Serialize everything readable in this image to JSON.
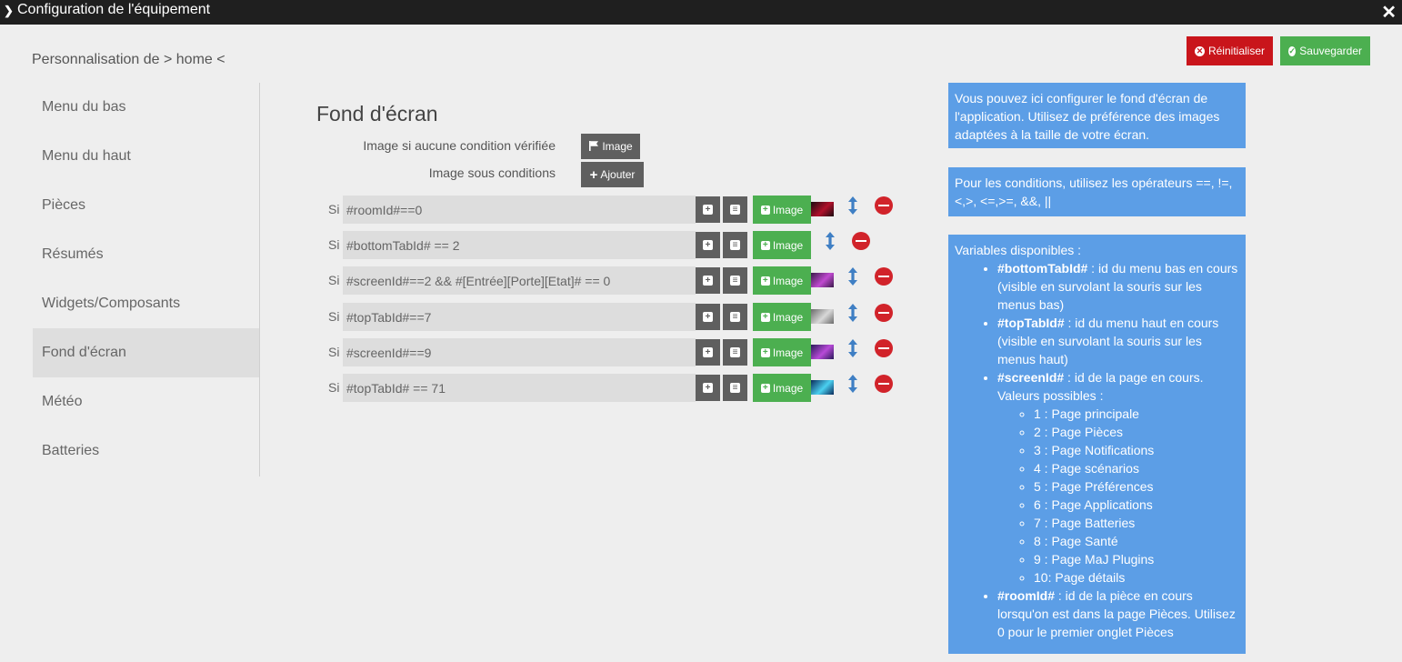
{
  "window": {
    "title": "Configuration de l'équipement"
  },
  "subtitle": "Personnalisation de > home <",
  "toolbar": {
    "reset_label": "Réinitialiser",
    "save_label": "Sauvegarder"
  },
  "sidebar": {
    "items": [
      {
        "label": "Menu du bas"
      },
      {
        "label": "Menu du haut"
      },
      {
        "label": "Pièces"
      },
      {
        "label": "Résumés"
      },
      {
        "label": "Widgets/Composants"
      },
      {
        "label": "Fond d'écran"
      },
      {
        "label": "Météo"
      },
      {
        "label": "Batteries"
      }
    ],
    "active_index": 5
  },
  "main": {
    "title": "Fond d'écran",
    "default_label": "Image si aucune condition vérifiée",
    "conditions_label": "Image sous conditions",
    "image_button_label": "Image",
    "add_button_label": "Ajouter",
    "si_label": "Si",
    "rows": [
      {
        "expr": "#roomId#==0",
        "thumb_colors": [
          "#1a0a10",
          "#b0102a"
        ]
      },
      {
        "expr": "#bottomTabId# == 2",
        "thumb_colors": []
      },
      {
        "expr": "#screenId#==2 && #[Entrée][Porte][Etat]# == 0",
        "thumb_colors": [
          "#3a1a4a",
          "#c04ad0"
        ]
      },
      {
        "expr": "#topTabId#==7",
        "thumb_colors": [
          "#6a6a6a",
          "#d8d8d8"
        ]
      },
      {
        "expr": "#screenId#==9",
        "thumb_colors": [
          "#2a1a5a",
          "#b84ad8"
        ]
      },
      {
        "expr": "#topTabId# == 71",
        "thumb_colors": [
          "#0a2a5a",
          "#4ad0f0"
        ]
      }
    ]
  },
  "info": {
    "box1": "Vous pouvez ici configurer le fond d'écran de l'application. Utilisez de préférence des images adaptées à la taille de votre écran.",
    "box2": "Pour les conditions, utilisez les opérateurs ==, !=, <,>, <=,>=, &&, ||",
    "vars_title": "Variables disponibles :",
    "bottom_key": "#bottomTabId#",
    "bottom_desc": " : id du menu bas en cours (visible en survolant la souris sur les menus bas)",
    "top_key": "#topTabId#",
    "top_desc": " : id du menu haut en cours (visible en survolant la souris sur les menus haut)",
    "screen_key": "#screenId#",
    "screen_desc": " : id de la page en cours. Valeurs possibles :",
    "pages": [
      "1 : Page principale",
      "2 : Page Pièces",
      "3 : Page Notifications",
      "4 : Page scénarios",
      "5 : Page Préférences",
      "6 : Page Applications",
      "7 : Page Batteries",
      "8 : Page Santé",
      "9 : Page MaJ Plugins",
      "10: Page détails"
    ],
    "room_key": "#roomId#",
    "room_desc": " : id de la pièce en cours lorsqu'on est dans la page Pièces. Utilisez 0 pour le premier onglet Pièces"
  },
  "colors": {
    "accent_green": "#4caf50",
    "accent_red": "#c9151b",
    "info_blue": "#5c9ee6",
    "arrow_blue": "#3f7fc4"
  }
}
